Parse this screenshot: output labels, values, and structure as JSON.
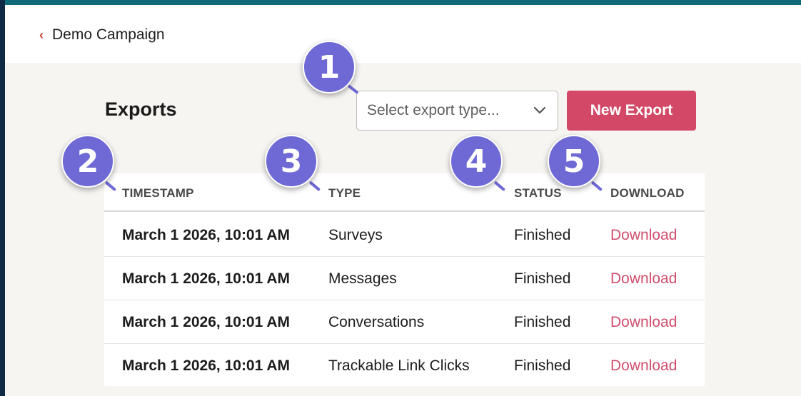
{
  "nav": {
    "back_label": "Demo Campaign"
  },
  "page": {
    "title": "Exports"
  },
  "controls": {
    "select_placeholder": "Select export type...",
    "new_export_label": "New Export"
  },
  "table": {
    "headers": [
      "TIMESTAMP",
      "TYPE",
      "STATUS",
      "DOWNLOAD"
    ],
    "rows": [
      {
        "timestamp": "March 1 2026, 10:01 AM",
        "type": "Surveys",
        "status": "Finished",
        "download": "Download"
      },
      {
        "timestamp": "March 1 2026, 10:01 AM",
        "type": "Messages",
        "status": "Finished",
        "download": "Download"
      },
      {
        "timestamp": "March 1 2026, 10:01 AM",
        "type": "Conversations",
        "status": "Finished",
        "download": "Download"
      },
      {
        "timestamp": "March 1 2026, 10:01 AM",
        "type": "Trackable Link Clicks",
        "status": "Finished",
        "download": "Download"
      }
    ]
  },
  "annotations": [
    "1",
    "2",
    "3",
    "4",
    "5"
  ],
  "colors": {
    "accent": "#d34866",
    "link": "#d14e6e",
    "badge": "#6f69d6",
    "top_border": "#0f6b7a"
  }
}
